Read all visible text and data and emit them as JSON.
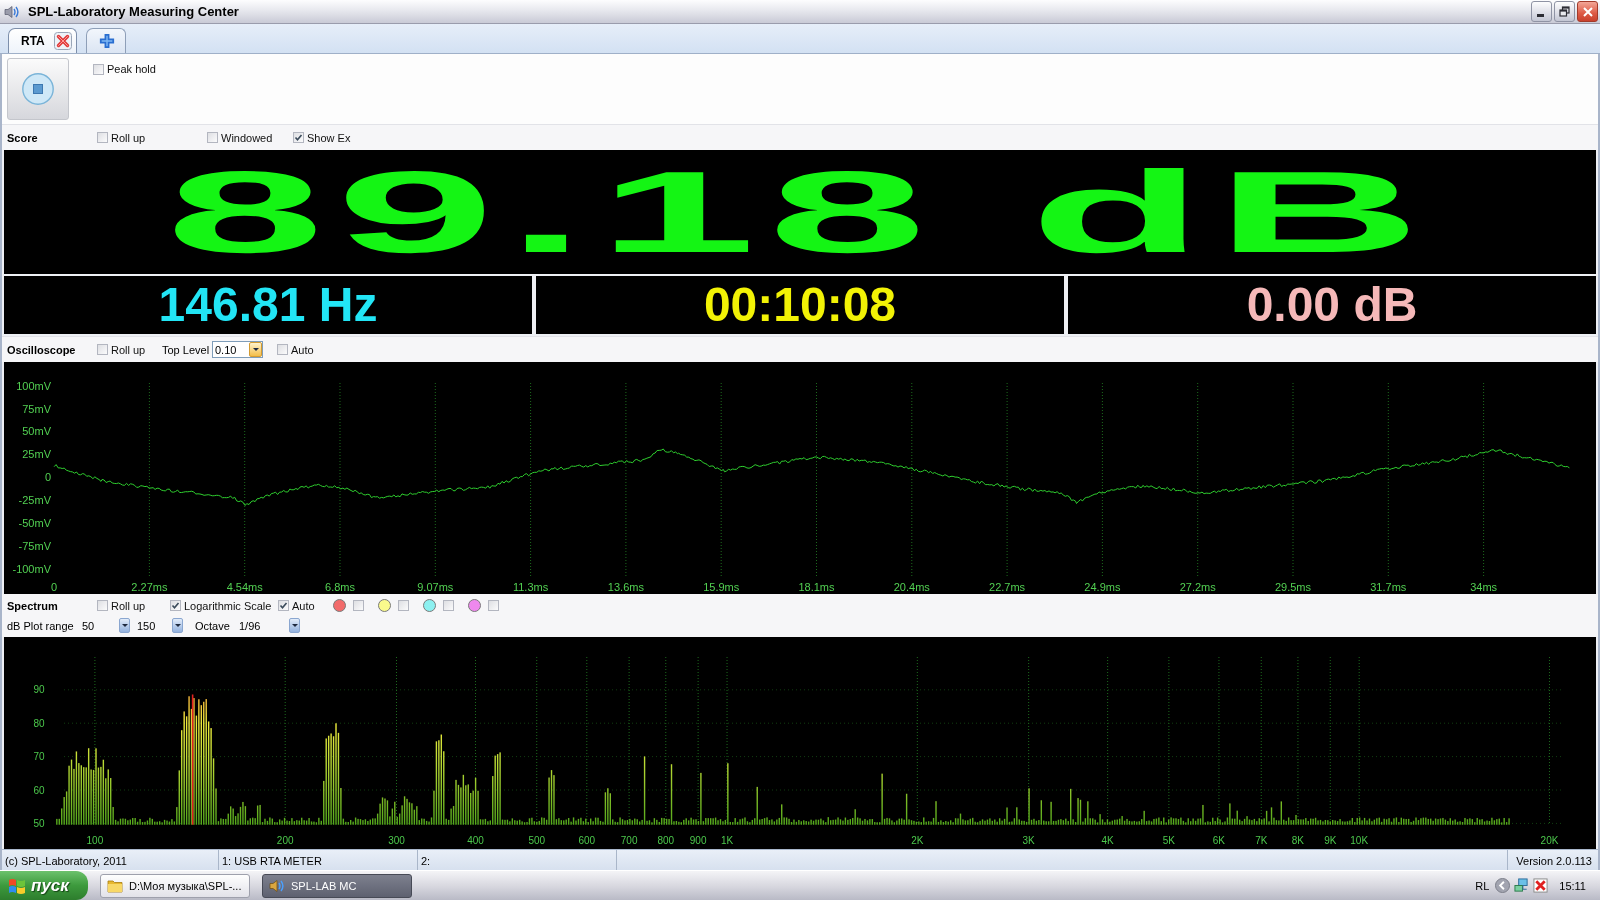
{
  "window": {
    "title": "SPL-Laboratory Measuring Center"
  },
  "tabs": [
    {
      "kind": "page",
      "label": "RTA",
      "selected": true
    },
    {
      "kind": "add",
      "selected": false
    }
  ],
  "controls": {
    "peak_hold": {
      "label": "Peak hold",
      "checked": false
    }
  },
  "score": {
    "title": "Score",
    "options": [
      {
        "label": "Roll up",
        "checked": false
      },
      {
        "label": "Windowed",
        "checked": false
      },
      {
        "label": "Show Ex",
        "checked": true
      }
    ],
    "value": "89.18 dB",
    "readouts": [
      {
        "text": "146.81 Hz",
        "color": "#22e5f5"
      },
      {
        "text": "00:10:08",
        "color": "#f2f205"
      },
      {
        "text": "0.00 dB",
        "color": "#f5b8b8"
      }
    ]
  },
  "oscilloscope": {
    "title": "Oscilloscope",
    "roll_up": {
      "label": "Roll up",
      "checked": false
    },
    "top_level": {
      "label": "Top Level",
      "value": "0.10"
    },
    "auto": {
      "label": "Auto",
      "checked": false
    },
    "y_labels": [
      "100mV",
      "75mV",
      "50mV",
      "25mV",
      "0",
      "-25mV",
      "-50mV",
      "-75mV",
      "-100mV"
    ],
    "x_labels": [
      "0",
      "2.27ms",
      "4.54ms",
      "6.8ms",
      "9.07ms",
      "11.3ms",
      "13.6ms",
      "15.9ms",
      "18.1ms",
      "20.4ms",
      "22.7ms",
      "24.9ms",
      "27.2ms",
      "29.5ms",
      "31.7ms",
      "34ms"
    ]
  },
  "spectrum": {
    "title": "Spectrum",
    "options": [
      {
        "label": "Roll up",
        "checked": false
      },
      {
        "label": "Logarithmic Scale",
        "checked": true
      },
      {
        "label": "Auto",
        "checked": true
      }
    ],
    "traces": [
      {
        "color": "#f26b6b",
        "checked": false
      },
      {
        "color": "#fafa8c",
        "checked": false
      },
      {
        "color": "#8cf0f0",
        "checked": false
      },
      {
        "color": "#ee88ee",
        "checked": false
      }
    ],
    "plot_range": {
      "label": "dB Plot range",
      "min": "50",
      "max": "150"
    },
    "octave": {
      "label": "Octave",
      "value": "1/96"
    },
    "y_labels": [
      "90",
      "80",
      "70",
      "60",
      "50"
    ],
    "x_labels": [
      "100",
      "200",
      "300",
      "400",
      "500",
      "600",
      "700",
      "800",
      "900",
      "1K",
      "2K",
      "3K",
      "4K",
      "5K",
      "6K",
      "7K",
      "8K",
      "9K",
      "10K",
      "20K"
    ]
  },
  "status_bar": {
    "cells": [
      "(c) SPL-Laboratory, 2011",
      "1: USB RTA METER",
      "2:"
    ],
    "version": "Version 2.0.113"
  },
  "taskbar": {
    "start": "пуск",
    "tasks": [
      {
        "kind": "folder",
        "label": "D:\\Моя музыка\\SPL-...",
        "selected": false
      },
      {
        "kind": "app",
        "label": "SPL-LAB MC",
        "selected": true
      }
    ],
    "tray": {
      "language": "RL",
      "clock": "15:11"
    }
  }
}
